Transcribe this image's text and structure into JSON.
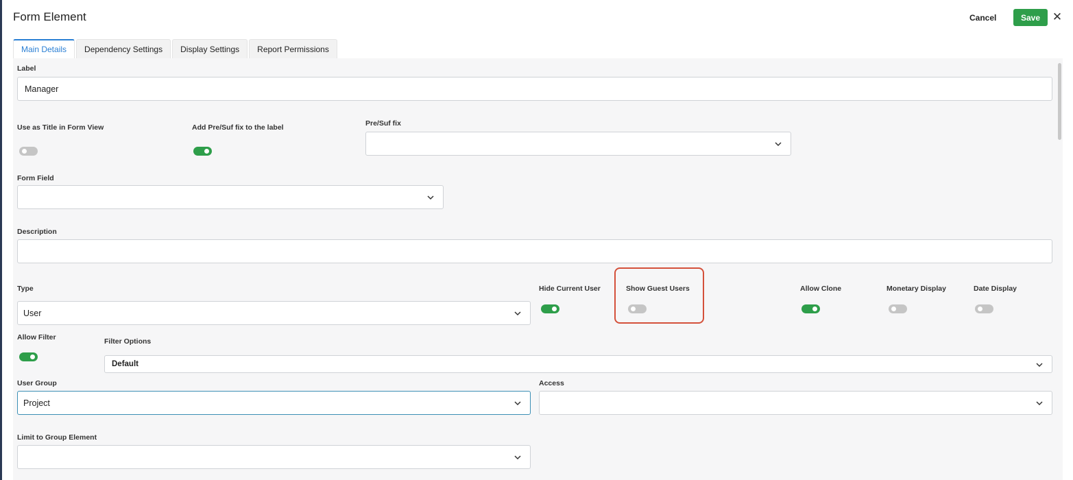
{
  "dialog": {
    "title": "Form Element",
    "cancel_label": "Cancel",
    "save_label": "Save",
    "close_glyph": "✕"
  },
  "tabs": [
    {
      "label": "Main Details",
      "active": true
    },
    {
      "label": "Dependency Settings",
      "active": false
    },
    {
      "label": "Display Settings",
      "active": false
    },
    {
      "label": "Report Permissions",
      "active": false
    }
  ],
  "fields": {
    "label": {
      "label": "Label",
      "value": "Manager"
    },
    "use_as_title": {
      "label": "Use as Title in Form View",
      "on": false
    },
    "add_presuf": {
      "label": "Add Pre/Suf fix to the label",
      "on": true
    },
    "presuf": {
      "label": "Pre/Suf fix",
      "value": ""
    },
    "form_field": {
      "label": "Form Field",
      "value": ""
    },
    "description": {
      "label": "Description",
      "value": ""
    },
    "type": {
      "label": "Type",
      "value": "User"
    },
    "hide_current_user": {
      "label": "Hide Current User",
      "on": true
    },
    "show_guest_users": {
      "label": "Show Guest Users",
      "on": false
    },
    "allow_clone": {
      "label": "Allow Clone",
      "on": true
    },
    "monetary_display": {
      "label": "Monetary Display",
      "on": false
    },
    "date_display": {
      "label": "Date Display",
      "on": false
    },
    "allow_filter": {
      "label": "Allow Filter",
      "on": true
    },
    "filter_options": {
      "label": "Filter Options",
      "value": "Default"
    },
    "user_group": {
      "label": "User Group",
      "value": "Project"
    },
    "access": {
      "label": "Access",
      "value": ""
    },
    "limit_group": {
      "label": "Limit to Group Element",
      "value": ""
    }
  },
  "colors": {
    "accent": "#2a7fd4",
    "toggle_on": "#2e9e4a",
    "toggle_off": "#c5c5c5",
    "save": "#2e9e4a",
    "highlight": "#d4503a"
  }
}
